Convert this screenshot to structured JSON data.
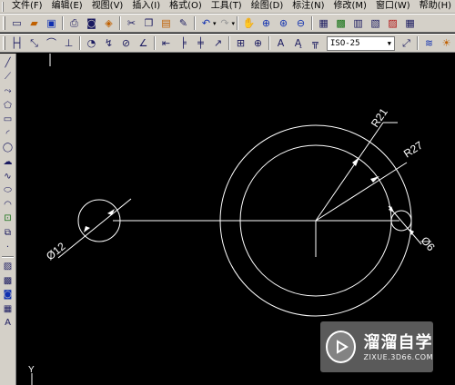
{
  "menubar": {
    "items": [
      {
        "label": "文件(F)"
      },
      {
        "label": "编辑(E)"
      },
      {
        "label": "视图(V)"
      },
      {
        "label": "插入(I)"
      },
      {
        "label": "格式(O)"
      },
      {
        "label": "工具(T)"
      },
      {
        "label": "绘图(D)"
      },
      {
        "label": "标注(N)"
      },
      {
        "label": "修改(M)"
      },
      {
        "label": "窗口(W)"
      },
      {
        "label": "帮助(H)"
      }
    ]
  },
  "toolbar_standard": {
    "icons": [
      "new-icon",
      "open-icon",
      "save-icon",
      "print-icon",
      "plot-preview-icon",
      "publish-icon",
      "cut-icon",
      "copy-icon",
      "paste-icon",
      "match-properties-icon",
      "undo-icon",
      "redo-icon",
      "pan-icon",
      "zoom-realtime-icon",
      "zoom-window-icon",
      "zoom-previous-icon",
      "properties-icon",
      "design-center-icon",
      "tool-palettes-icon",
      "sheet-set-icon",
      "markup-icon",
      "calculator-icon"
    ]
  },
  "toolbar_dimension": {
    "dimstyle_value": "ISO-25",
    "icons": [
      "dim-linear-icon",
      "dim-aligned-icon",
      "dim-arc-icon",
      "dim-ordinate-icon",
      "dim-radius-icon",
      "dim-jogged-icon",
      "dim-diameter-icon",
      "dim-angular-icon",
      "quick-dim-icon",
      "dim-baseline-icon",
      "dim-continue-icon",
      "quick-leader-icon",
      "tolerance-icon",
      "center-mark-icon",
      "dim-edit-icon",
      "dim-text-edit-icon",
      "dim-update-icon",
      "dim-style-icon",
      "layers-icon",
      "light-bulb-icon"
    ]
  },
  "draw_toolbar": {
    "icons": [
      "line-icon",
      "construction-line-icon",
      "polyline-icon",
      "polygon-icon",
      "rectangle-icon",
      "arc-icon",
      "circle-icon",
      "revision-cloud-icon",
      "spline-icon",
      "ellipse-icon",
      "ellipse-arc-icon",
      "insert-block-icon",
      "make-block-icon",
      "point-icon",
      "hatch-icon",
      "gradient-icon",
      "region-icon",
      "table-icon",
      "multiline-text-icon"
    ]
  },
  "drawing": {
    "dimensions": {
      "small_diameter": "Ø12",
      "outer_radius": "R21",
      "right_radius": "R27",
      "right_diameter": "Ø6"
    },
    "ucs_label": "Y",
    "line_color": "#ffffff",
    "background_color": "#000000"
  },
  "watermark": {
    "brand": "溜溜自学",
    "url": "ZIXUE.3D66.COM"
  }
}
